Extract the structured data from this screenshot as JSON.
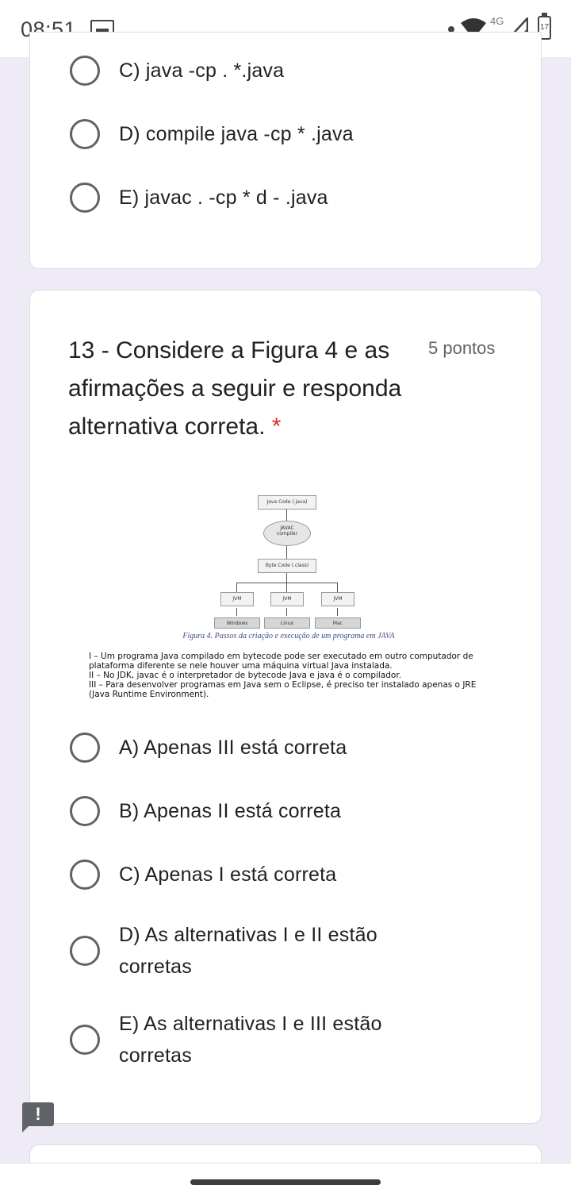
{
  "status_bar": {
    "time": "08:51",
    "network": "4G",
    "battery": "17"
  },
  "previous_question": {
    "options": [
      {
        "label": "C) java -cp . *.java"
      },
      {
        "label": "D) compile java -cp * .java"
      },
      {
        "label": "E) javac . -cp * d - .java"
      }
    ]
  },
  "question13": {
    "title": "13 - Considere a Figura 4 e as afirmações a seguir e responda alternativa correta.",
    "required_mark": "*",
    "points": "5 pontos",
    "figure": {
      "java_code": "Java Code (.java)",
      "javac": "JAVAC",
      "compiler": "compiler",
      "byte_code": "Byte Code (.class)",
      "jvm_labels": [
        "JVM",
        "JVM",
        "JVM"
      ],
      "platforms": [
        "Windows",
        "Linux",
        "Mac"
      ],
      "caption": "Figura 4. Passos da criação e execução de um programa em JAVA",
      "statements": [
        "I – Um programa Java compilado em bytecode pode ser executado em outro computador de plataforma diferente se nele houver uma máquina virtual Java instalada.",
        "II – No JDK, javac é o interpretador de bytecode Java e java é o compilador.",
        "III – Para desenvolver programas em Java sem o Eclipse, é preciso ter instalado apenas o JRE (Java Runtime Environment)."
      ]
    },
    "options": [
      {
        "label": "A) Apenas III está correta"
      },
      {
        "label": "B) Apenas II está correta"
      },
      {
        "label": "C) Apenas I está correta"
      },
      {
        "label": "D) As alternativas I e II estão corretas"
      },
      {
        "label": "E) As alternativas I e III estão corretas"
      }
    ]
  },
  "feedback": {
    "icon_text": "!"
  }
}
